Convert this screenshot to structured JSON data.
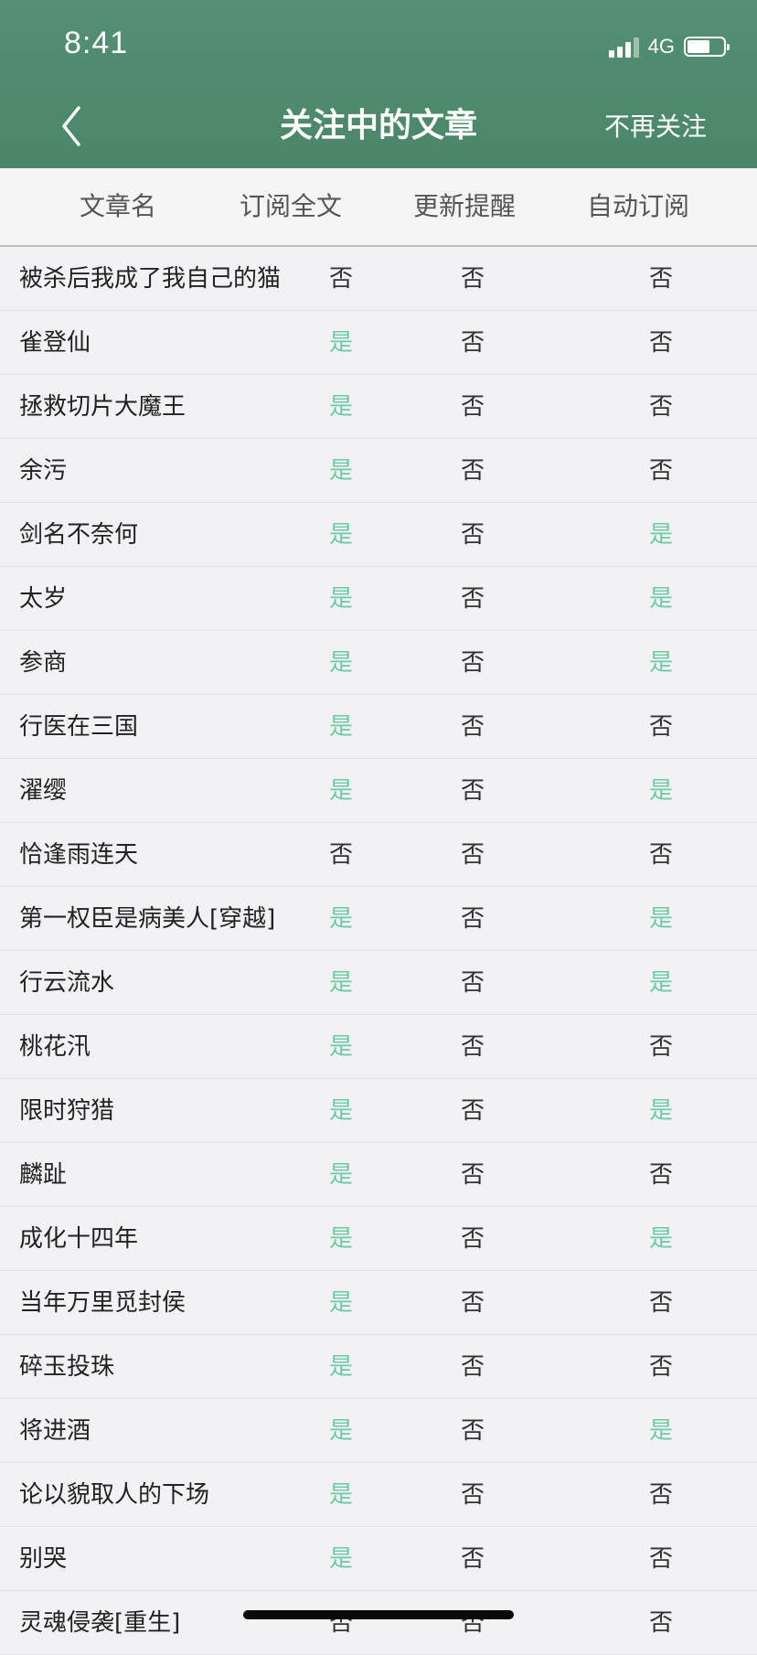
{
  "status_bar": {
    "time": "8:41",
    "network": "4G",
    "icons": [
      "signal-icon",
      "battery-icon"
    ]
  },
  "nav": {
    "back_icon": "chevron-left-icon",
    "title": "关注中的文章",
    "right_action": "不再关注"
  },
  "colors": {
    "header_bg": "#4a8767",
    "yes_text": "#6ccba3",
    "no_text": "#333333",
    "row_bg": "#f2f2f5"
  },
  "columns": [
    "文章名",
    "订阅全文",
    "更新提醒",
    "自动订阅"
  ],
  "rows": [
    {
      "title": "被杀后我成了我自己的猫",
      "full": "否",
      "remind": "否",
      "auto": "否"
    },
    {
      "title": "雀登仙",
      "full": "是",
      "remind": "否",
      "auto": "否"
    },
    {
      "title": "拯救切片大魔王",
      "full": "是",
      "remind": "否",
      "auto": "否"
    },
    {
      "title": "余污",
      "full": "是",
      "remind": "否",
      "auto": "否"
    },
    {
      "title": "剑名不奈何",
      "full": "是",
      "remind": "否",
      "auto": "是"
    },
    {
      "title": "太岁",
      "full": "是",
      "remind": "否",
      "auto": "是"
    },
    {
      "title": "参商",
      "full": "是",
      "remind": "否",
      "auto": "是"
    },
    {
      "title": "行医在三国",
      "full": "是",
      "remind": "否",
      "auto": "否"
    },
    {
      "title": "濯缨",
      "full": "是",
      "remind": "否",
      "auto": "是"
    },
    {
      "title": "恰逢雨连天",
      "full": "否",
      "remind": "否",
      "auto": "否"
    },
    {
      "title": "第一权臣是病美人[穿越]",
      "full": "是",
      "remind": "否",
      "auto": "是"
    },
    {
      "title": "行云流水",
      "full": "是",
      "remind": "否",
      "auto": "是"
    },
    {
      "title": "桃花汛",
      "full": "是",
      "remind": "否",
      "auto": "否"
    },
    {
      "title": "限时狩猎",
      "full": "是",
      "remind": "否",
      "auto": "是"
    },
    {
      "title": "麟趾",
      "full": "是",
      "remind": "否",
      "auto": "否"
    },
    {
      "title": "成化十四年",
      "full": "是",
      "remind": "否",
      "auto": "是"
    },
    {
      "title": "当年万里觅封侯",
      "full": "是",
      "remind": "否",
      "auto": "否"
    },
    {
      "title": "碎玉投珠",
      "full": "是",
      "remind": "否",
      "auto": "否"
    },
    {
      "title": "将进酒",
      "full": "是",
      "remind": "否",
      "auto": "是"
    },
    {
      "title": "论以貌取人的下场",
      "full": "是",
      "remind": "否",
      "auto": "否"
    },
    {
      "title": "别哭",
      "full": "是",
      "remind": "否",
      "auto": "否"
    },
    {
      "title": "灵魂侵袭[重生]",
      "full": "否",
      "remind": "否",
      "auto": "否"
    }
  ]
}
